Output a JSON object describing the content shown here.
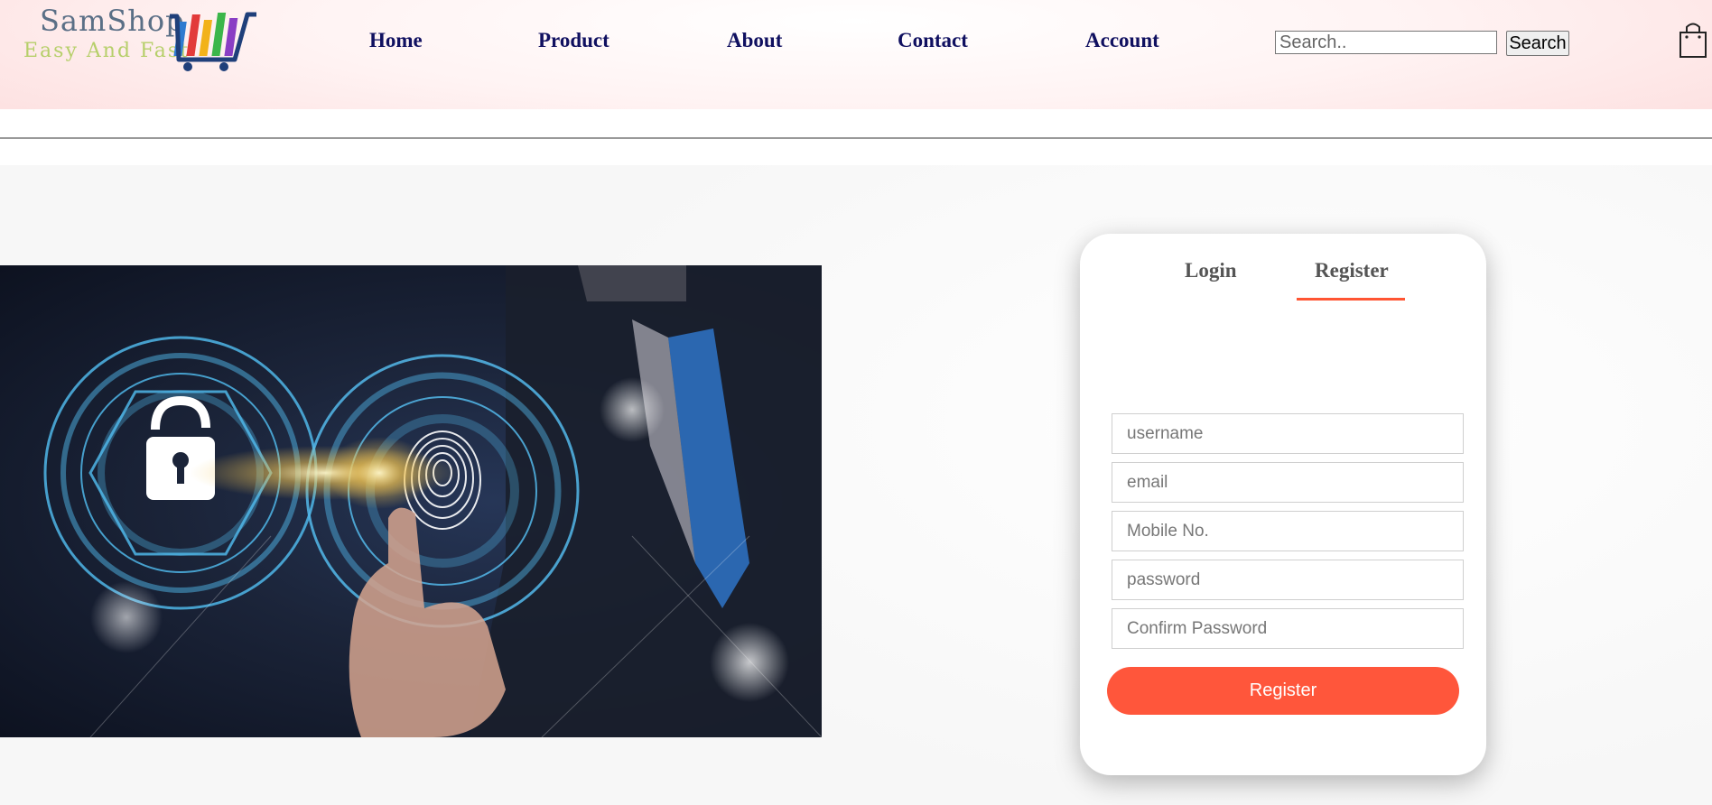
{
  "brand": {
    "name": "SamShop",
    "tagline": "Easy And Fast"
  },
  "nav": {
    "items": [
      "Home",
      "Product",
      "About",
      "Contact",
      "Account"
    ]
  },
  "search": {
    "placeholder": "Search..",
    "button_label": "Search"
  },
  "icons": {
    "cart": "shopping-bag-icon",
    "logo": "shopping-cart-logo-icon",
    "hero": "fingerprint-unlock-image"
  },
  "auth": {
    "tabs": [
      "Login",
      "Register"
    ],
    "active_tab": "Register",
    "fields": [
      {
        "name": "username",
        "placeholder": "username"
      },
      {
        "name": "email",
        "placeholder": "email"
      },
      {
        "name": "mobile",
        "placeholder": "Mobile No."
      },
      {
        "name": "password",
        "placeholder": "password"
      },
      {
        "name": "confirm_password",
        "placeholder": "Confirm Password"
      }
    ],
    "submit_label": "Register"
  },
  "colors": {
    "accent": "#ff563b",
    "nav_text": "#101060",
    "header_bg": "#fde2e2"
  }
}
